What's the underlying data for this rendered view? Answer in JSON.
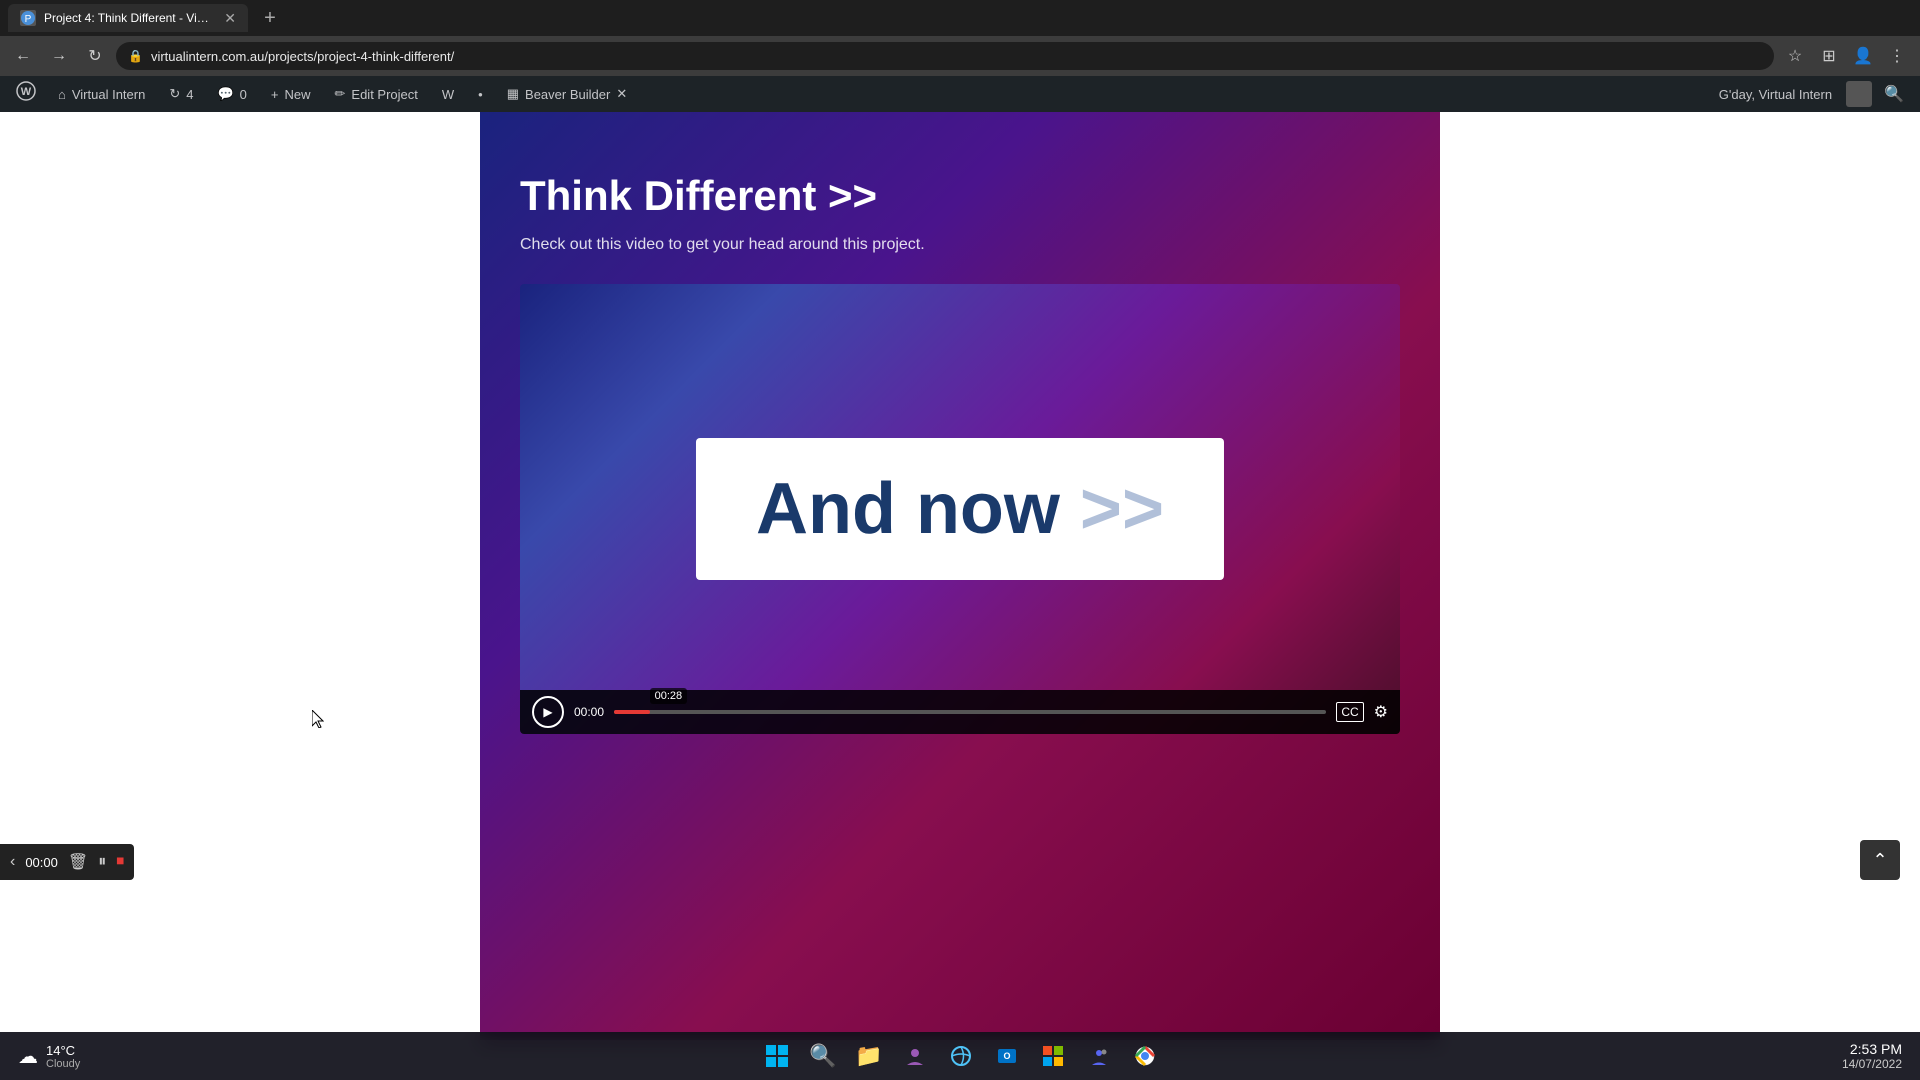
{
  "browser": {
    "tab": {
      "title": "Project 4: Think Different - Virtu...",
      "favicon": "🌐"
    },
    "address": "virtualintern.com.au/projects/project-4-think-different/",
    "address_icon": "🔒"
  },
  "wp_admin": {
    "wp_icon": "W",
    "site_name": "Virtual Intern",
    "updates": "4",
    "comments": "0",
    "new_label": "New",
    "edit_label": "Edit Project",
    "beaver_builder": "Beaver Builder",
    "greeting": "G'day, Virtual Intern",
    "search_icon": "🔍"
  },
  "hero": {
    "title": "Think Different >>",
    "subtitle": "Check out this video to get your head around this project."
  },
  "video": {
    "text_main": "And now >>",
    "current_time": "00:00",
    "tooltip_time": "00:28",
    "progress_percent": 5
  },
  "floating_panel": {
    "time": "00:00"
  },
  "taskbar": {
    "weather_temp": "14°C",
    "weather_condition": "Cloudy",
    "time": "2:53 PM",
    "date": "14/07/2022"
  }
}
